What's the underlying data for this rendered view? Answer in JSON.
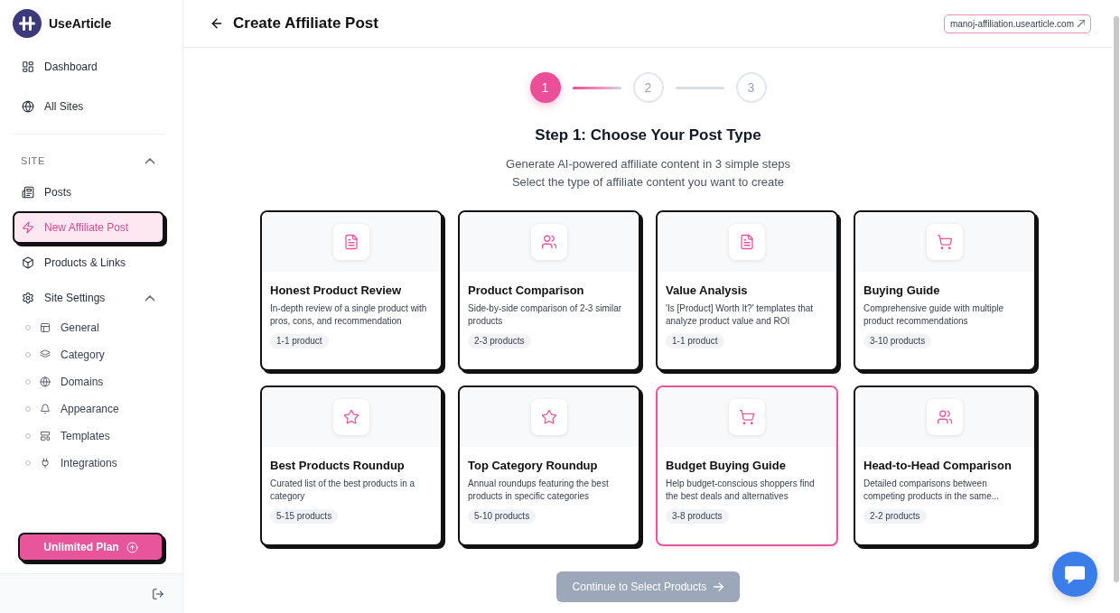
{
  "sidebar": {
    "brand": "UseArticle",
    "nav": [
      {
        "label": "Dashboard",
        "kind": "dashboard",
        "selected": false
      },
      {
        "label": "All Sites",
        "kind": "globe",
        "selected": false
      }
    ],
    "sections": [
      {
        "title": "SITE",
        "expanded": true,
        "items": [
          {
            "label": "Posts",
            "kind": "newspaper",
            "selected": false
          },
          {
            "label": "New Affiliate Post",
            "kind": "bolt",
            "selected": true
          },
          {
            "label": "Products & Links",
            "kind": "box",
            "selected": false
          },
          {
            "label": "Site Settings",
            "kind": "gear",
            "selected": false,
            "expanded": true,
            "children": [
              {
                "label": "General",
                "kind": "layout",
                "selected": false
              },
              {
                "label": "Category",
                "kind": "layers",
                "selected": false
              },
              {
                "label": "Domains",
                "kind": "globe",
                "selected": false
              },
              {
                "label": "Appearance",
                "kind": "bell",
                "selected": false
              },
              {
                "label": "Templates",
                "kind": "template",
                "selected": false
              },
              {
                "label": "Integrations",
                "kind": "plug",
                "selected": false
              }
            ]
          }
        ]
      }
    ],
    "plan_button": {
      "label": "Unlimited Plan"
    }
  },
  "header": {
    "title": "Create Affiliate Post",
    "site_link": "manoj-affiliation.usearticle.com"
  },
  "stepper": {
    "steps": [
      {
        "label": "1",
        "active": true
      },
      {
        "label": "2",
        "active": false
      },
      {
        "label": "3",
        "active": false
      }
    ]
  },
  "heading": "Step 1: Choose Your Post Type",
  "subtitle_lines": [
    "Generate AI-powered affiliate content in 3 simple steps",
    "Select the type of affiliate content you want to create"
  ],
  "post_types": [
    {
      "title": "Honest Product Review",
      "description": "In-depth review of a single product with pros, cons, and recommendation",
      "tag": "1-1 product",
      "kind": "document",
      "hovered": false
    },
    {
      "title": "Product Comparison",
      "description": "Side-by-side comparison of 2-3 similar products",
      "tag": "2-3 products",
      "kind": "users",
      "hovered": false
    },
    {
      "title": "Value Analysis",
      "description": "'Is [Product] Worth It?' templates that analyze product value and ROI",
      "tag": "1-1 product",
      "kind": "document",
      "hovered": false
    },
    {
      "title": "Buying Guide",
      "description": "Comprehensive guide with multiple product recommendations",
      "tag": "3-10 products",
      "kind": "cart",
      "hovered": false
    },
    {
      "title": "Best Products Roundup",
      "description": "Curated list of the best products in a category",
      "tag": "5-15 products",
      "kind": "star",
      "hovered": false
    },
    {
      "title": "Top Category Roundup",
      "description": "Annual roundups featuring the best products in specific categories",
      "tag": "5-10 products",
      "kind": "star",
      "hovered": false
    },
    {
      "title": "Budget Buying Guide",
      "description": "Help budget-conscious shoppers find the best deals and alternatives",
      "tag": "3-8 products",
      "kind": "cart",
      "hovered": true
    },
    {
      "title": "Head-to-Head Comparison",
      "description": "Detailed comparisons between competing products in the same...",
      "tag": "2-2 products",
      "kind": "users",
      "hovered": false
    }
  ],
  "continue_button": {
    "label": "Continue to Select Products",
    "disabled": true
  }
}
